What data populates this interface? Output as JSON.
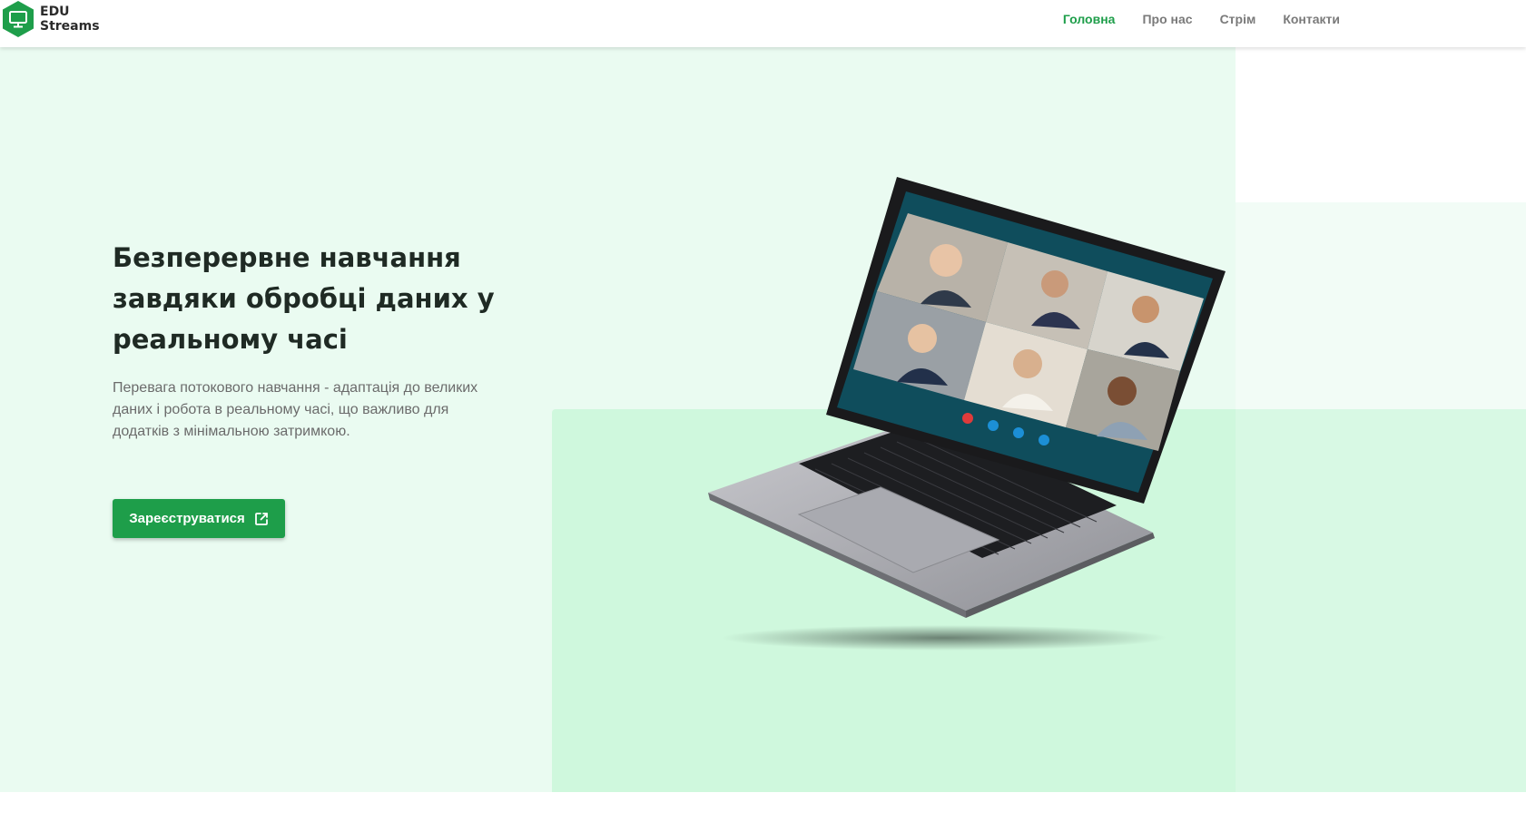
{
  "logo": {
    "line1": "EDU",
    "line2": "Streams",
    "icon": "monitor-icon",
    "color": "#1e9e4a"
  },
  "nav": {
    "items": [
      {
        "label": "Головна",
        "active": true
      },
      {
        "label": "Про нас",
        "active": false
      },
      {
        "label": "Стрім",
        "active": false
      },
      {
        "label": "Контакти",
        "active": false
      }
    ]
  },
  "hero": {
    "title_line1": "Безперервне навчання",
    "title_line2": "завдяки обробці даних у",
    "title_line3": "реальному часі",
    "description": "Перевага потокового навчання - адаптація до великих даних і робота в реальному часі, що важливо для додатків з мінімальною затримкою.",
    "cta_label": "Зареєструватися",
    "cta_icon": "external-link-icon"
  },
  "colors": {
    "accent": "#1e9e4a",
    "bg_light": "#eafbf1",
    "bg_block": "#cff8dd"
  }
}
